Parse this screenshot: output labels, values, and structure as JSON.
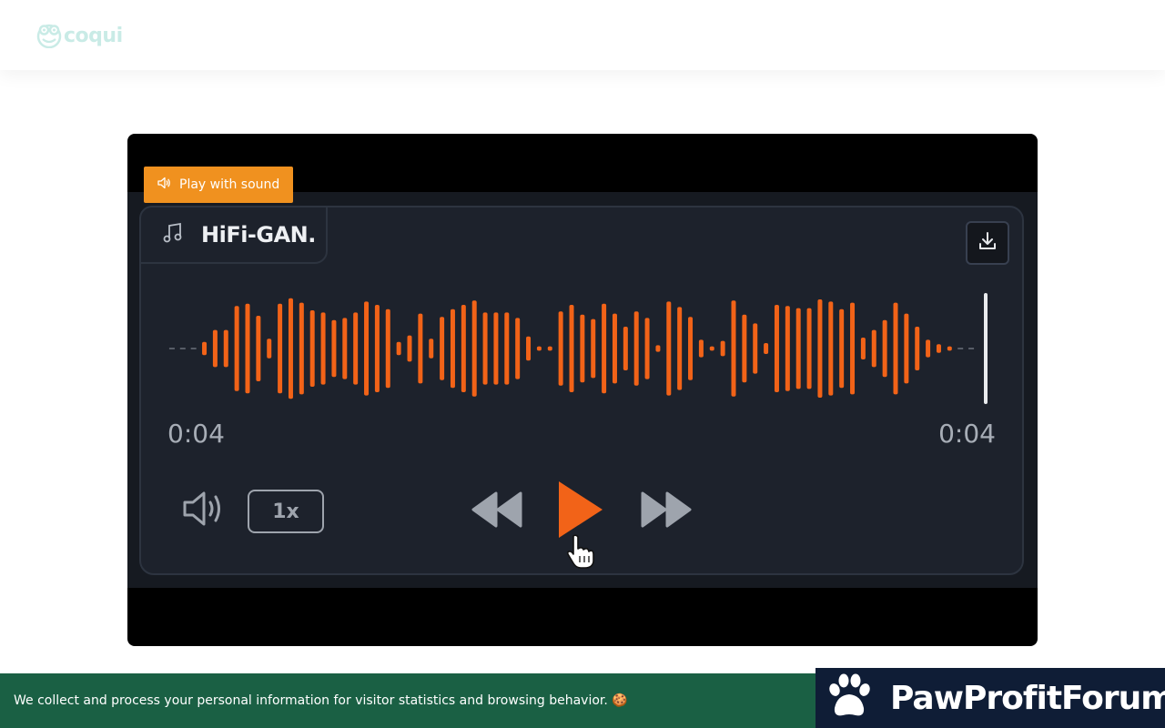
{
  "header": {
    "logo_text": "coqui",
    "logo_icon": "frog-icon",
    "logo_color": "#c9ebe6"
  },
  "video": {
    "sound_button_label": "Play with sound",
    "sound_button_icon": "speaker-icon",
    "accent_color": "#f0911f"
  },
  "player": {
    "track_title": "HiFi-GAN.",
    "track_icon": "music-note-icon",
    "download_icon": "download-icon",
    "current_time": "0:04",
    "duration": "0:04",
    "progress": 1.0,
    "speed_label": "1x",
    "volume_icon": "volume-icon",
    "rewind_icon": "rewind-icon",
    "play_icon": "play-icon",
    "forward_icon": "fast-forward-icon",
    "waveform_color": "#f26318",
    "waveform_amplitudes": [
      0,
      0,
      0,
      0.12,
      0.34,
      0.34,
      0.78,
      0.82,
      0.6,
      0.18,
      0.82,
      0.92,
      0.84,
      0.7,
      0.66,
      0.52,
      0.56,
      0.66,
      0.86,
      0.8,
      0.72,
      0.12,
      0.24,
      0.64,
      0.18,
      0.58,
      0.72,
      0.8,
      0.88,
      0.66,
      0.66,
      0.66,
      0.56,
      0.22,
      0.04,
      0.04,
      0.68,
      0.8,
      0.62,
      0.54,
      0.82,
      0.64,
      0.4,
      0.68,
      0.56,
      0.06,
      0.86,
      0.76,
      0.58,
      0.16,
      0.04,
      0.14,
      0.88,
      0.62,
      0.46,
      0.1,
      0.8,
      0.78,
      0.74,
      0.74,
      0.9,
      0.86,
      0.72,
      0.84,
      0.2,
      0.34,
      0.52,
      0.84,
      0.64,
      0.4,
      0.16,
      0.08,
      0.04,
      0,
      0
    ]
  },
  "cookie_banner": {
    "text": "We collect and process your personal information for visitor statistics and browsing behavior. 🍪"
  },
  "badge": {
    "text": "PawProfitForum",
    "icon": "paw-icon"
  }
}
